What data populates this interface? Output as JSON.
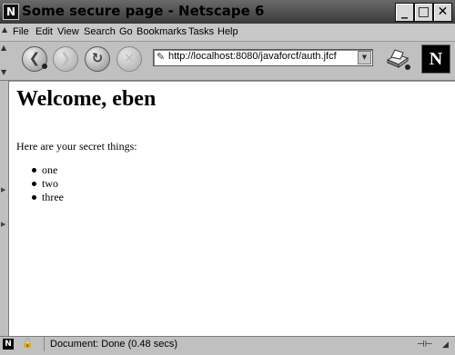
{
  "window": {
    "title": "Some secure page - Netscape 6"
  },
  "menu": [
    "File",
    "Edit",
    "View",
    "Search",
    "Go",
    "Bookmarks",
    "Tasks",
    "Help"
  ],
  "nav": {
    "back_glyph": "❮",
    "forward_glyph": "❯",
    "reload_glyph": "↻",
    "stop_glyph": "✕",
    "url": "http://localhost:8080/javaforcf/auth.jfcf"
  },
  "page": {
    "heading": "Welcome, eben",
    "intro": "Here are your secret things:",
    "items": [
      "one",
      "two",
      "three"
    ]
  },
  "status": {
    "text": "Document: Done (0.48 secs)"
  },
  "logo": {
    "letter": "N"
  }
}
